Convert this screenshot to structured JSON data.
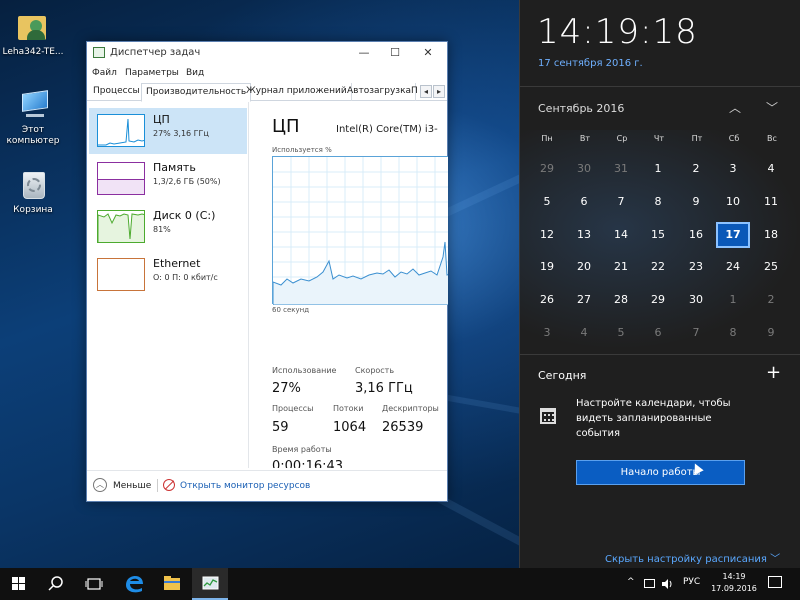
{
  "desktop": {
    "icons": [
      {
        "label": "Leha342-TE..."
      },
      {
        "label": "Этот компьютер"
      },
      {
        "label": "Корзина"
      }
    ]
  },
  "task_manager": {
    "title": "Диспетчер задач",
    "controls": {
      "minimize": "—",
      "maximize": "☐",
      "close": "✕"
    },
    "menu": [
      "Файл",
      "Параметры",
      "Вид"
    ],
    "tabs": [
      "Процессы",
      "Производительность",
      "Журнал приложений",
      "Автозагрузка",
      "П"
    ],
    "active_tab": "Производительность",
    "tab_arrows": {
      "left": "◂",
      "right": "▸"
    },
    "resources": [
      {
        "name": "ЦП",
        "sub": "27% 3,16 ГГц",
        "color": "#1a8fd8"
      },
      {
        "name": "Память",
        "sub": "1,3/2,6 ГБ (50%)",
        "color": "#8b2fa0"
      },
      {
        "name": "Диск 0 (C:)",
        "sub": "81%",
        "color": "#4caa2e"
      },
      {
        "name": "Ethernet",
        "sub": "О: 0 П: 0 кбит/с",
        "color": "#c8743a"
      }
    ],
    "detail": {
      "heading": "ЦП",
      "model": "Intel(R) Core(TM) i3-",
      "utilization_label": "Используется %",
      "seconds_label": "60 секунд",
      "utilization": {
        "label": "Использование",
        "value": "27%"
      },
      "speed": {
        "label": "Скорость",
        "value": "3,16 ГГц"
      },
      "processes": {
        "label": "Процессы",
        "value": "59"
      },
      "threads": {
        "label": "Потоки",
        "value": "1064"
      },
      "handles": {
        "label": "Дескрипторы",
        "value": "26539"
      },
      "uptime": {
        "label": "Время работы",
        "value": "0:00:16:43"
      }
    },
    "footer": {
      "less_label": "Меньше",
      "monitor_label": "Открыть монитор ресурсов"
    }
  },
  "flyout": {
    "time": "14:19:18",
    "date": "17 сентября 2016 г.",
    "month": "Сентябрь 2016",
    "nav_up": "︿",
    "nav_down": "﹀",
    "weekdays": [
      "Пн",
      "Вт",
      "Ср",
      "Чт",
      "Пт",
      "Сб",
      "Вс"
    ],
    "days": [
      [
        "29",
        "30",
        "31",
        "1",
        "2",
        "3",
        "4"
      ],
      [
        "5",
        "6",
        "7",
        "8",
        "9",
        "10",
        "11"
      ],
      [
        "12",
        "13",
        "14",
        "15",
        "16",
        "17",
        "18"
      ],
      [
        "19",
        "20",
        "21",
        "22",
        "23",
        "24",
        "25"
      ],
      [
        "26",
        "27",
        "28",
        "29",
        "30",
        "1",
        "2"
      ],
      [
        "3",
        "4",
        "5",
        "6",
        "7",
        "8",
        "9"
      ]
    ],
    "today": "17",
    "today_label": "Сегодня",
    "add_symbol": "+",
    "promo_text": "Настройте календари, чтобы видеть запланированные события",
    "start_button": "Начало работы",
    "hide_schedule": "Скрыть настройку расписания  ﹀"
  },
  "taskbar": {
    "language": "РУС",
    "tray_arrow": "^",
    "time": "14:19",
    "date": "17.09.2016"
  }
}
